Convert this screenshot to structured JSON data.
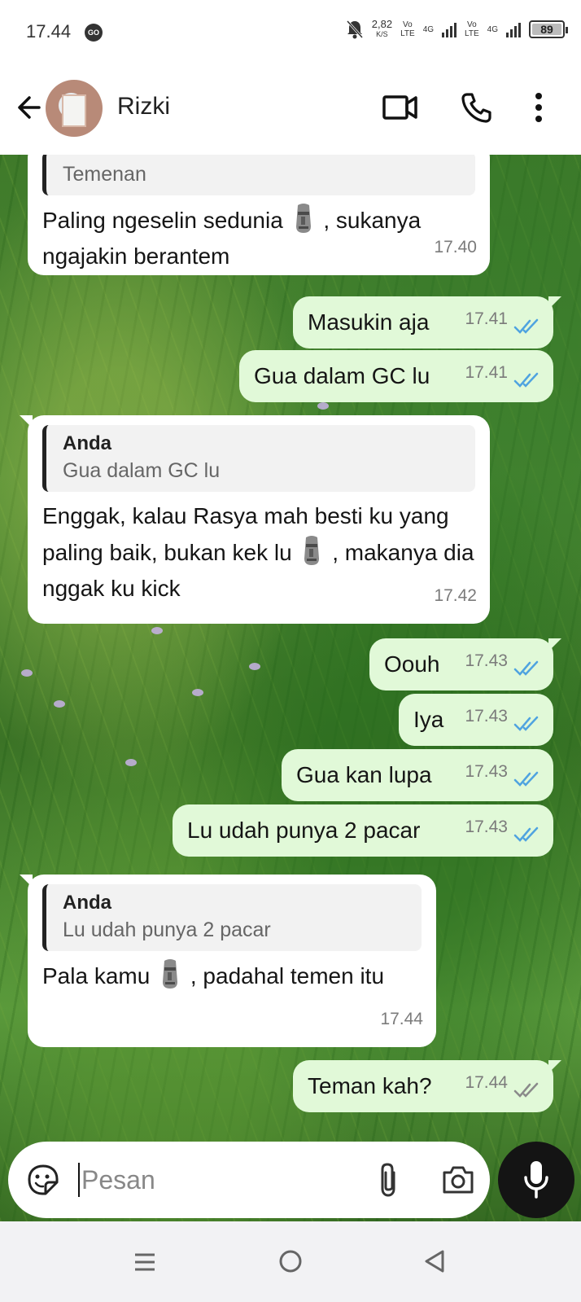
{
  "status_bar": {
    "time": "17.44",
    "go_badge": "GO",
    "speed_value": "2,82",
    "speed_unit": "K/S",
    "net1_top": "Vo",
    "net1_bottom": "LTE",
    "net1_gen": "4G",
    "net2_top": "Vo",
    "net2_bottom": "LTE",
    "net2_gen": "4G",
    "battery": "89"
  },
  "header": {
    "contact_name": "Rizki",
    "icons": [
      "back-arrow-icon",
      "video-call-icon",
      "phone-icon",
      "more-vert-icon"
    ]
  },
  "messages": [
    {
      "dir": "in",
      "quote_author": "",
      "quote_text": "Temenan",
      "text_a": "Paling ngeselin sedunia",
      "text_b": ", sukanya ngajakin berantem",
      "time": "17.40"
    },
    {
      "dir": "out",
      "text": "Masukin aja",
      "time": "17.41",
      "status": "read"
    },
    {
      "dir": "out",
      "text": "Gua dalam GC lu",
      "time": "17.41",
      "status": "read"
    },
    {
      "dir": "in",
      "quote_author": "Anda",
      "quote_text": "Gua dalam GC lu",
      "text_a": "Enggak, kalau Rasya mah besti ku yang paling baik, bukan kek lu",
      "text_b": ", makanya dia nggak ku kick",
      "time": "17.42"
    },
    {
      "dir": "out",
      "text": "Oouh",
      "time": "17.43",
      "status": "read"
    },
    {
      "dir": "out",
      "text": "Iya",
      "time": "17.43",
      "status": "read"
    },
    {
      "dir": "out",
      "text": "Gua kan lupa",
      "time": "17.43",
      "status": "read"
    },
    {
      "dir": "out",
      "text": "Lu udah punya 2 pacar",
      "time": "17.43",
      "status": "read"
    },
    {
      "dir": "in",
      "quote_author": "Anda",
      "quote_text": "Lu udah punya 2 pacar",
      "text_a": "Pala kamu",
      "text_b": ", padahal temen itu",
      "time": "17.44"
    },
    {
      "dir": "out",
      "text": "Teman kah?",
      "time": "17.44",
      "status": "delivered"
    }
  ],
  "composer": {
    "placeholder": "Pesan",
    "icons": [
      "sticker-icon",
      "attach-icon",
      "camera-icon",
      "mic-icon"
    ]
  },
  "colors": {
    "outgoing_bubble": "#e1f9d8",
    "incoming_bubble": "#ffffff",
    "read_ticks": "#4fa3e0",
    "delivered_ticks": "#8a8a8a",
    "mic_button": "#141414"
  }
}
